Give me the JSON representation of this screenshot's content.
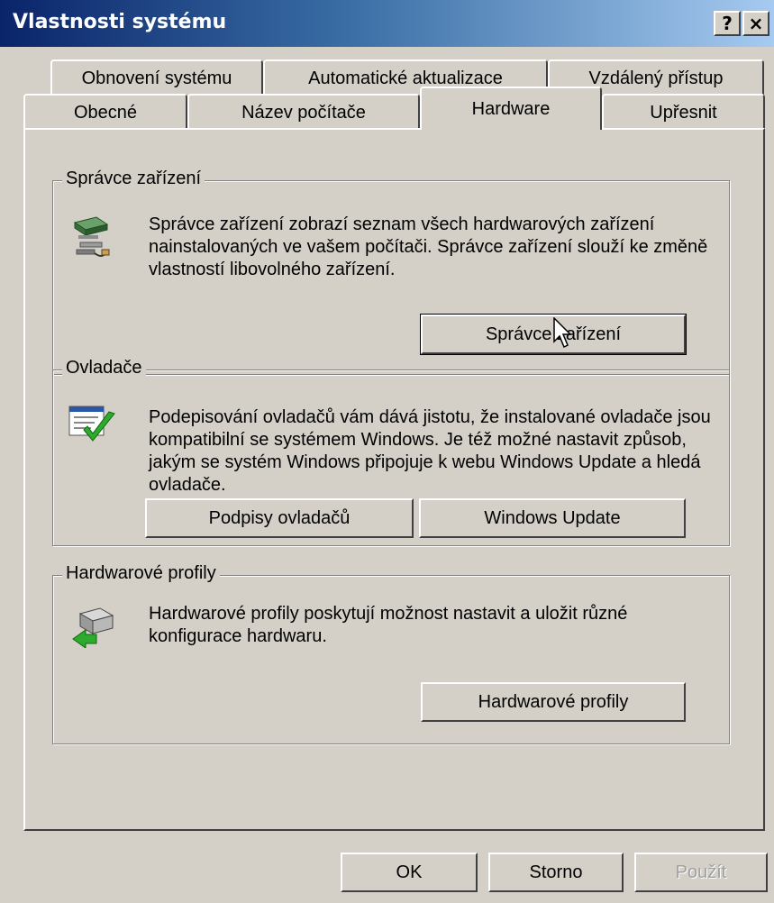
{
  "window": {
    "title": "Vlastnosti systému",
    "help_label": "?",
    "close_label": "×"
  },
  "tabs": {
    "row1": [
      "Obnovení systému",
      "Automatické aktualizace",
      "Vzdálený přístup"
    ],
    "row2": [
      "Obecné",
      "Název počítače",
      "Hardware",
      "Upřesnit"
    ],
    "selected": "Hardware"
  },
  "device_manager": {
    "legend": "Správce zařízení",
    "icon": "device-manager-icon",
    "description": "Správce zařízení zobrazí seznam všech hardwarových zařízení nainstalovaných ve vašem počítači. Správce zařízení slouží ke změně vlastností libovolného zařízení.",
    "button": "Správce zařízení"
  },
  "drivers": {
    "legend": "Ovladače",
    "icon": "driver-signing-icon",
    "description": "Podepisování ovladačů vám dává jistotu, že instalované ovladače jsou kompatibilní se systémem Windows. Je též možné nastavit způsob, jakým se systém Windows připojuje k webu Windows Update a hledá ovladače.",
    "signing_button": "Podpisy ovladačů",
    "update_button": "Windows Update"
  },
  "hardware_profiles": {
    "legend": "Hardwarové profily",
    "icon": "hardware-profiles-icon",
    "description": "Hardwarové profily poskytují možnost nastavit a uložit různé konfigurace hardwaru.",
    "button": "Hardwarové profily"
  },
  "footer": {
    "ok": "OK",
    "cancel": "Storno",
    "apply": "Použít"
  },
  "colors": {
    "title_start": "#0a246a",
    "title_end": "#a6caf0",
    "face": "#d4d0c8"
  }
}
